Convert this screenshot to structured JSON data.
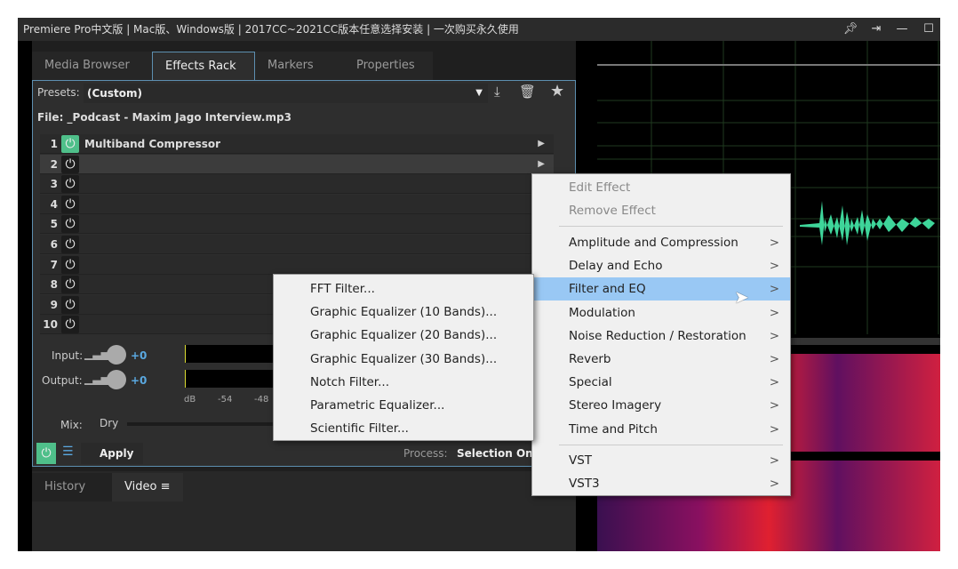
{
  "window": {
    "title": "Premiere Pro中文版 | Mac版、Windows版 | 2017CC~2021CC版本任意选择安装 | 一次购买永久使用",
    "buttons": [
      "pin",
      "dock",
      "minimize",
      "maximize"
    ]
  },
  "tabs": [
    {
      "label": "Media Browser"
    },
    {
      "label": "Effects Rack",
      "active": true
    },
    {
      "label": "Markers"
    },
    {
      "label": "Properties"
    }
  ],
  "rack": {
    "presets_label": "Presets:",
    "presets_value": "(Custom)",
    "file": "File: _Podcast - Maxim Jago Interview.mp3",
    "slots": [
      {
        "n": "1",
        "name": "Multiband Compressor",
        "on": true
      },
      {
        "n": "2",
        "name": ""
      },
      {
        "n": "3",
        "name": ""
      },
      {
        "n": "4",
        "name": ""
      },
      {
        "n": "5",
        "name": ""
      },
      {
        "n": "6",
        "name": ""
      },
      {
        "n": "7",
        "name": ""
      },
      {
        "n": "8",
        "name": ""
      },
      {
        "n": "9",
        "name": ""
      },
      {
        "n": "10",
        "name": ""
      }
    ],
    "input_label": "Input:",
    "input_value": "+0",
    "output_label": "Output:",
    "output_value": "+0",
    "meter_ticks": [
      "dB",
      "-54",
      "-48"
    ],
    "mix_label": "Mix:",
    "mix_value": "Dry",
    "apply": "Apply",
    "process_label": "Process:",
    "process_value": "Selection Only"
  },
  "bottom_tabs": [
    {
      "label": "History"
    },
    {
      "label": "Video",
      "active": true
    }
  ],
  "context_menu": {
    "items": [
      {
        "label": "Edit Effect",
        "disabled": true
      },
      {
        "label": "Remove Effect",
        "disabled": true
      }
    ],
    "categories": [
      "Amplitude and Compression",
      "Delay and Echo",
      "Filter and EQ",
      "Modulation",
      "Noise Reduction / Restoration",
      "Reverb",
      "Special",
      "Stereo Imagery",
      "Time and Pitch"
    ],
    "highlighted": "Filter and EQ",
    "plugins": [
      "VST",
      "VST3"
    ]
  },
  "submenu": {
    "items": [
      "FFT Filter...",
      "Graphic Equalizer (10 Bands)...",
      "Graphic Equalizer (20 Bands)...",
      "Graphic Equalizer (30 Bands)...",
      "Notch Filter...",
      "Parametric Equalizer...",
      "Scientific Filter..."
    ]
  },
  "colors": {
    "accent": "#5d8fb0",
    "power_on": "#4fbf8a",
    "waveform": "#3ed59a",
    "highlight": "#99c8f4"
  }
}
